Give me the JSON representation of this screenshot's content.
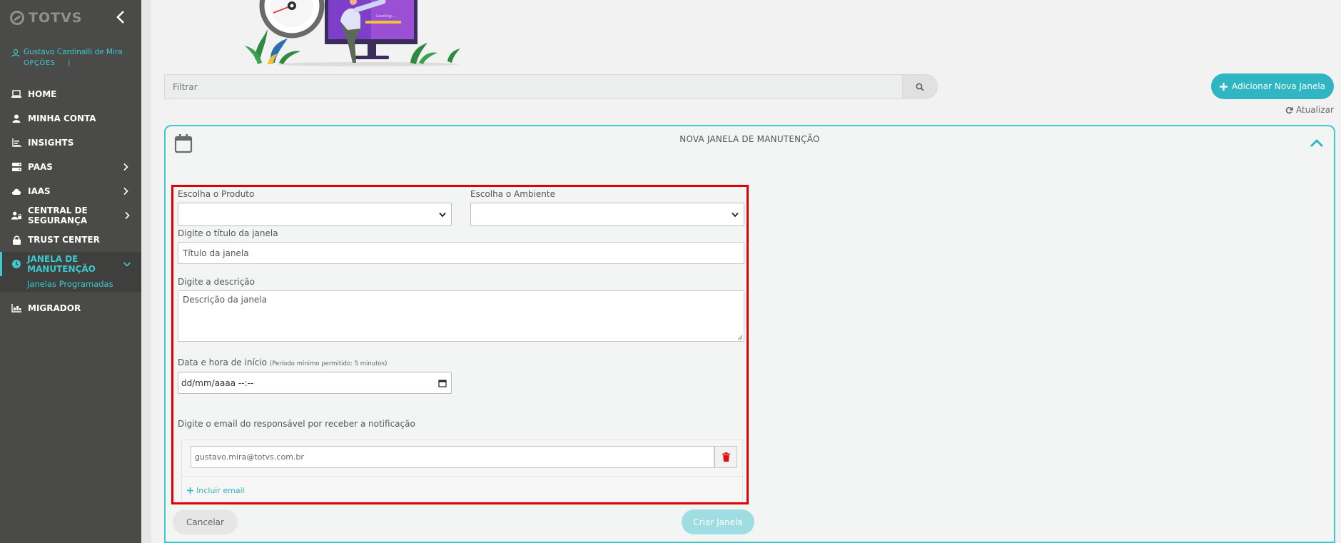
{
  "app": {
    "logo_text": "TOTVS"
  },
  "user": {
    "name": "Gustavo Cardinalli de Mira",
    "options_label": "OPÇÕES",
    "options_sep": "|"
  },
  "nav": {
    "items": [
      {
        "label": "HOME",
        "icon": "laptop-icon"
      },
      {
        "label": "MINHA CONTA",
        "icon": "user-icon"
      },
      {
        "label": "INSIGHTS",
        "icon": "chart-icon"
      },
      {
        "label": "PAAS",
        "icon": "server-icon"
      },
      {
        "label": "IAAS",
        "icon": "cloud-icon"
      },
      {
        "label": "CENTRAL DE SEGURANÇA",
        "icon": "user-lock-icon"
      },
      {
        "label": "TRUST CENTER",
        "icon": "lock-icon"
      },
      {
        "label": "JANELA DE MANUTENÇÃO",
        "icon": "clock-icon"
      },
      {
        "label": "MIGRADOR",
        "icon": "migrate-icon"
      }
    ],
    "sub_item": "Janelas Programadas"
  },
  "illustration": {
    "screen_text": "Loading..."
  },
  "toolbar": {
    "filter_placeholder": "Filtrar",
    "add_label": "Adicionar Nova Janela",
    "refresh_label": "Atualizar"
  },
  "card": {
    "title": "NOVA JANELA DE MANUTENÇÃO"
  },
  "form": {
    "product_label": "Escolha o Produto",
    "environment_label": "Escolha o Ambiente",
    "title_label": "Digite o título da janela",
    "title_placeholder": "Título da janela",
    "description_label": "Digite a descrição",
    "description_placeholder": "Descrição da janela",
    "start_label": "Data e hora de início",
    "start_hint": "(Período mínimo permitido: 5 minutos)",
    "start_value": "dd/mm/aaaa --:--",
    "email_label": "Digite o email do responsável por receber a notificação",
    "email_value": "gustavo.mira@totvs.com.br",
    "include_email": "Incluir email",
    "cancel": "Cancelar",
    "create": "Criar Janela"
  },
  "colors": {
    "accent": "#2fb6c2",
    "sidebar": "#4a4a48",
    "highlight": "#e00000"
  }
}
